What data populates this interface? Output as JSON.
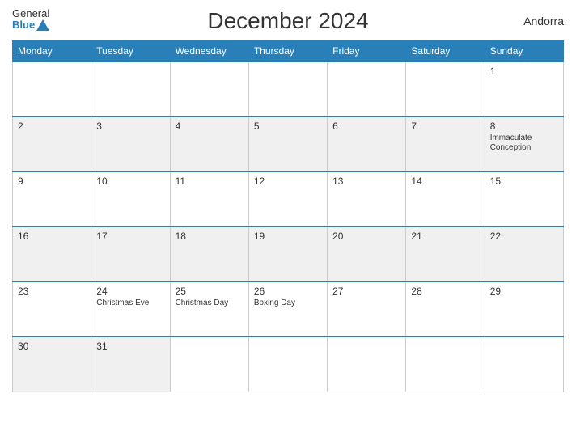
{
  "header": {
    "title": "December 2024",
    "country": "Andorra",
    "logo_general": "General",
    "logo_blue": "Blue"
  },
  "weekdays": [
    "Monday",
    "Tuesday",
    "Wednesday",
    "Thursday",
    "Friday",
    "Saturday",
    "Sunday"
  ],
  "weeks": [
    [
      {
        "day": "",
        "holiday": "",
        "gray": false,
        "empty": true
      },
      {
        "day": "",
        "holiday": "",
        "gray": false,
        "empty": true
      },
      {
        "day": "",
        "holiday": "",
        "gray": false,
        "empty": true
      },
      {
        "day": "",
        "holiday": "",
        "gray": false,
        "empty": true
      },
      {
        "day": "",
        "holiday": "",
        "gray": false,
        "empty": true
      },
      {
        "day": "",
        "holiday": "",
        "gray": false,
        "empty": true
      },
      {
        "day": "1",
        "holiday": "",
        "gray": false,
        "empty": false
      }
    ],
    [
      {
        "day": "2",
        "holiday": "",
        "gray": true,
        "empty": false
      },
      {
        "day": "3",
        "holiday": "",
        "gray": true,
        "empty": false
      },
      {
        "day": "4",
        "holiday": "",
        "gray": true,
        "empty": false
      },
      {
        "day": "5",
        "holiday": "",
        "gray": true,
        "empty": false
      },
      {
        "day": "6",
        "holiday": "",
        "gray": true,
        "empty": false
      },
      {
        "day": "7",
        "holiday": "",
        "gray": true,
        "empty": false
      },
      {
        "day": "8",
        "holiday": "Immaculate Conception",
        "gray": true,
        "empty": false
      }
    ],
    [
      {
        "day": "9",
        "holiday": "",
        "gray": false,
        "empty": false
      },
      {
        "day": "10",
        "holiday": "",
        "gray": false,
        "empty": false
      },
      {
        "day": "11",
        "holiday": "",
        "gray": false,
        "empty": false
      },
      {
        "day": "12",
        "holiday": "",
        "gray": false,
        "empty": false
      },
      {
        "day": "13",
        "holiday": "",
        "gray": false,
        "empty": false
      },
      {
        "day": "14",
        "holiday": "",
        "gray": false,
        "empty": false
      },
      {
        "day": "15",
        "holiday": "",
        "gray": false,
        "empty": false
      }
    ],
    [
      {
        "day": "16",
        "holiday": "",
        "gray": true,
        "empty": false
      },
      {
        "day": "17",
        "holiday": "",
        "gray": true,
        "empty": false
      },
      {
        "day": "18",
        "holiday": "",
        "gray": true,
        "empty": false
      },
      {
        "day": "19",
        "holiday": "",
        "gray": true,
        "empty": false
      },
      {
        "day": "20",
        "holiday": "",
        "gray": true,
        "empty": false
      },
      {
        "day": "21",
        "holiday": "",
        "gray": true,
        "empty": false
      },
      {
        "day": "22",
        "holiday": "",
        "gray": true,
        "empty": false
      }
    ],
    [
      {
        "day": "23",
        "holiday": "",
        "gray": false,
        "empty": false
      },
      {
        "day": "24",
        "holiday": "Christmas Eve",
        "gray": false,
        "empty": false
      },
      {
        "day": "25",
        "holiday": "Christmas Day",
        "gray": false,
        "empty": false
      },
      {
        "day": "26",
        "holiday": "Boxing Day",
        "gray": false,
        "empty": false
      },
      {
        "day": "27",
        "holiday": "",
        "gray": false,
        "empty": false
      },
      {
        "day": "28",
        "holiday": "",
        "gray": false,
        "empty": false
      },
      {
        "day": "29",
        "holiday": "",
        "gray": false,
        "empty": false
      }
    ],
    [
      {
        "day": "30",
        "holiday": "",
        "gray": true,
        "empty": false
      },
      {
        "day": "31",
        "holiday": "",
        "gray": true,
        "empty": false
      },
      {
        "day": "",
        "holiday": "",
        "gray": true,
        "empty": true
      },
      {
        "day": "",
        "holiday": "",
        "gray": true,
        "empty": true
      },
      {
        "day": "",
        "holiday": "",
        "gray": true,
        "empty": true
      },
      {
        "day": "",
        "holiday": "",
        "gray": true,
        "empty": true
      },
      {
        "day": "",
        "holiday": "",
        "gray": true,
        "empty": true
      }
    ]
  ]
}
